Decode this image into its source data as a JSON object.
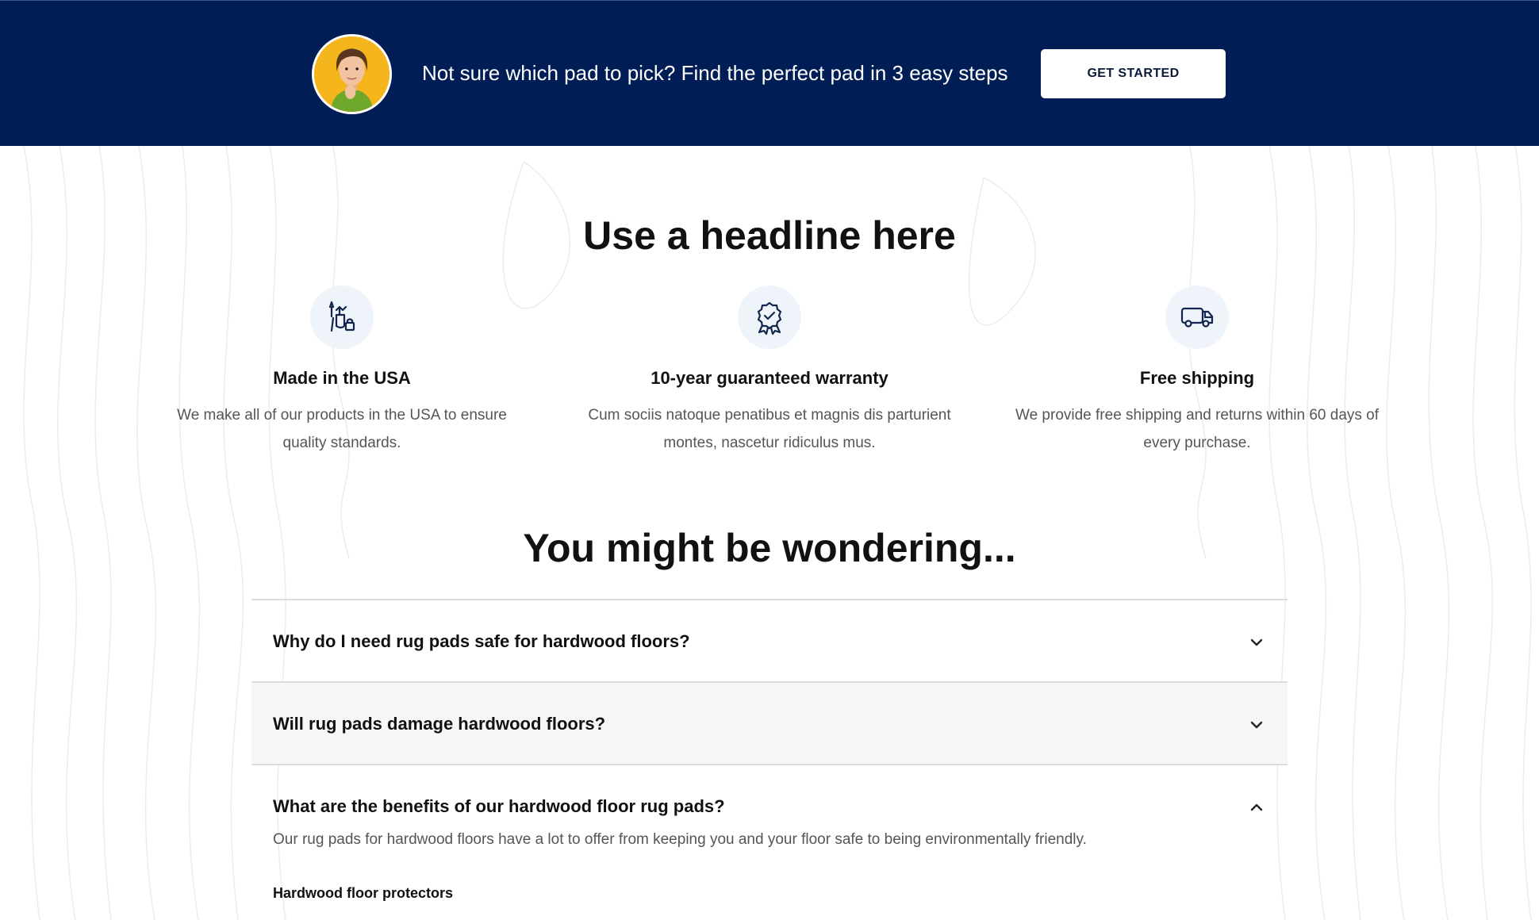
{
  "banner": {
    "text": "Not sure which pad to pick? Find the perfect pad in 3 easy steps",
    "button_label": "GET STARTED",
    "background_color": "#001e55"
  },
  "headline": "Use a headline here",
  "features": [
    {
      "icon": "made-in-usa-icon",
      "title": "Made in the USA",
      "description_line1": "We make all of our products in the USA to ensure",
      "description_line2": "quality standards."
    },
    {
      "icon": "warranty-badge-icon",
      "title": "10-year guaranteed warranty",
      "description_line1": "Cum sociis natoque penatibus et magnis dis parturient",
      "description_line2": "montes, nascetur ridiculus mus."
    },
    {
      "icon": "shipping-truck-icon",
      "title": "Free shipping",
      "description_line1": "We provide free shipping and returns within 60 days of",
      "description_line2": "every purchase."
    }
  ],
  "faq": {
    "title": "You might be wondering...",
    "items": [
      {
        "question": "Why do I need rug pads safe for hardwood floors?",
        "expanded": false
      },
      {
        "question": "Will rug pads damage hardwood floors?",
        "expanded": false
      },
      {
        "question": "What are the benefits of our hardwood floor rug pads?",
        "expanded": true,
        "answer": "Our rug pads for hardwood floors have a lot to offer from keeping you and your floor safe to being environmentally friendly.",
        "subheading": "Hardwood floor protectors"
      }
    ]
  }
}
